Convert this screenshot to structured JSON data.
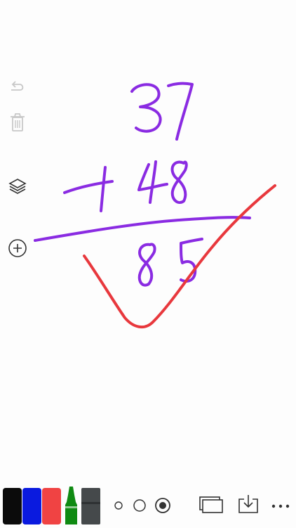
{
  "app": {
    "background": "#fdfdfd",
    "ink_colors": {
      "purple": "#8a2be2",
      "red": "#e8383d"
    }
  },
  "sidebar": {
    "items": [
      {
        "icon": "redo-icon",
        "enabled": false
      },
      {
        "icon": "trash-icon",
        "enabled": false
      },
      {
        "icon": "layers-icon",
        "enabled": true
      },
      {
        "icon": "add-circle-icon",
        "enabled": true
      }
    ]
  },
  "toolbar": {
    "markers": [
      {
        "icon": "black-marker-icon",
        "color": "#0b0b0b"
      },
      {
        "icon": "blue-marker-icon",
        "color": "#0a1adf"
      },
      {
        "icon": "red-marker-icon",
        "color": "#f04343"
      },
      {
        "icon": "green-marker-icon",
        "color": "#0f8a12"
      },
      {
        "icon": "eraser-icon",
        "color": "#45494b"
      }
    ],
    "brush_sizes": [
      "small",
      "medium",
      "large"
    ],
    "selected_brush_size": "large",
    "actions": [
      {
        "icon": "pages-icon"
      },
      {
        "icon": "export-icon"
      },
      {
        "icon": "more-icon"
      }
    ]
  }
}
